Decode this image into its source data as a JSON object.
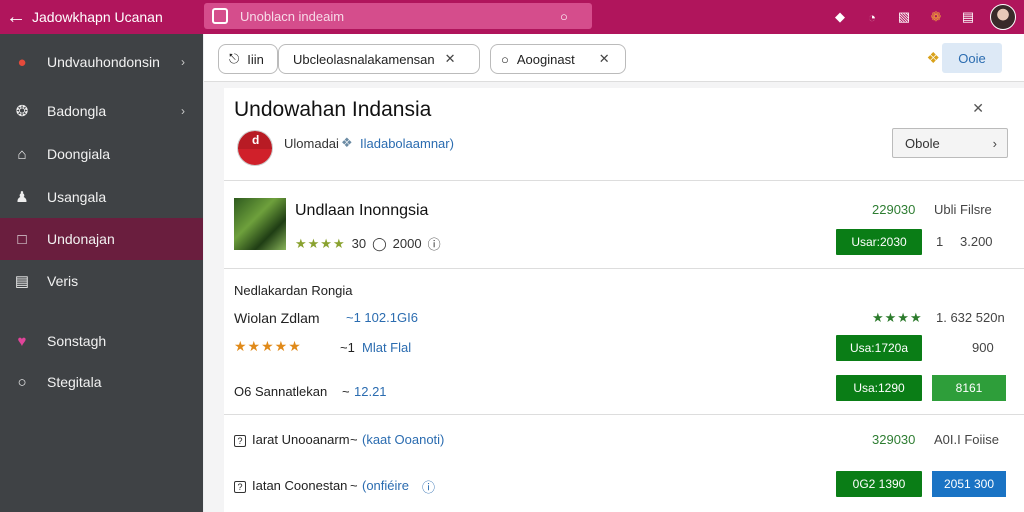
{
  "topbar": {
    "title": "Jadowkhapn Ucanan",
    "search_value": "Unoblacn indeaim"
  },
  "sidebar": {
    "items": [
      {
        "label": "Undvauhondonsin",
        "icon": "chrome-logo-icon"
      },
      {
        "label": "Badongla",
        "icon": "feather-icon"
      },
      {
        "label": "Doongiala",
        "icon": "home-icon"
      },
      {
        "label": "Usangala",
        "icon": "user-icon"
      },
      {
        "label": "Undonajan",
        "icon": "square-icon"
      },
      {
        "label": "Veris",
        "icon": "card-icon"
      },
      {
        "label": "Sonstagh",
        "icon": "heart-icon"
      },
      {
        "label": "Stegitala",
        "icon": "circle-icon"
      }
    ]
  },
  "toolbar": {
    "pill1_label": "Iiin",
    "pill2_value": "Ubcleolasnalakamensan",
    "pill3_value": "Aooginast",
    "done_label": "Ooie"
  },
  "panel": {
    "title": "Undowahan Indansia",
    "subtitle_left": "Ulomadai",
    "subtitle_right": "Iladabolaamnar)",
    "open_label": "Obole"
  },
  "product": {
    "title": "Undlaan Inonngsia",
    "stars": "★★★★",
    "rating_text": "30",
    "rating_extra": "2000",
    "price": "229030",
    "price_label": "Ubli Filsre",
    "buy_label": "Usar:2030",
    "qty_num": "1",
    "qty_value": "3.200"
  },
  "offers": {
    "header": "Nedlakardan Rongia",
    "rows": [
      {
        "left": "Wiolan Zdlam",
        "link": "~1 102.1GI6",
        "stars": "★★★★",
        "right": "1. 632 520n"
      },
      {
        "stars": "★★★★★",
        "left_num": "~1",
        "link": "Mlat Flal",
        "btn": "Usa:1720a",
        "right": "900"
      },
      {
        "left": "O6 Sannatlekan",
        "sep": "~",
        "link": "12.21",
        "btn": "Usa:1290",
        "btn2": "8161"
      },
      {
        "left": "Iarat Unooanarm",
        "sep": "~",
        "link": "(kaat Ooanoti)",
        "price": "329030",
        "right": "A0I.I Foiise"
      },
      {
        "left": "Iatan Coonestan",
        "sep": "~",
        "link": "(onfiéire",
        "btn": "0G2 1390",
        "btn2": "2051 300"
      }
    ]
  }
}
